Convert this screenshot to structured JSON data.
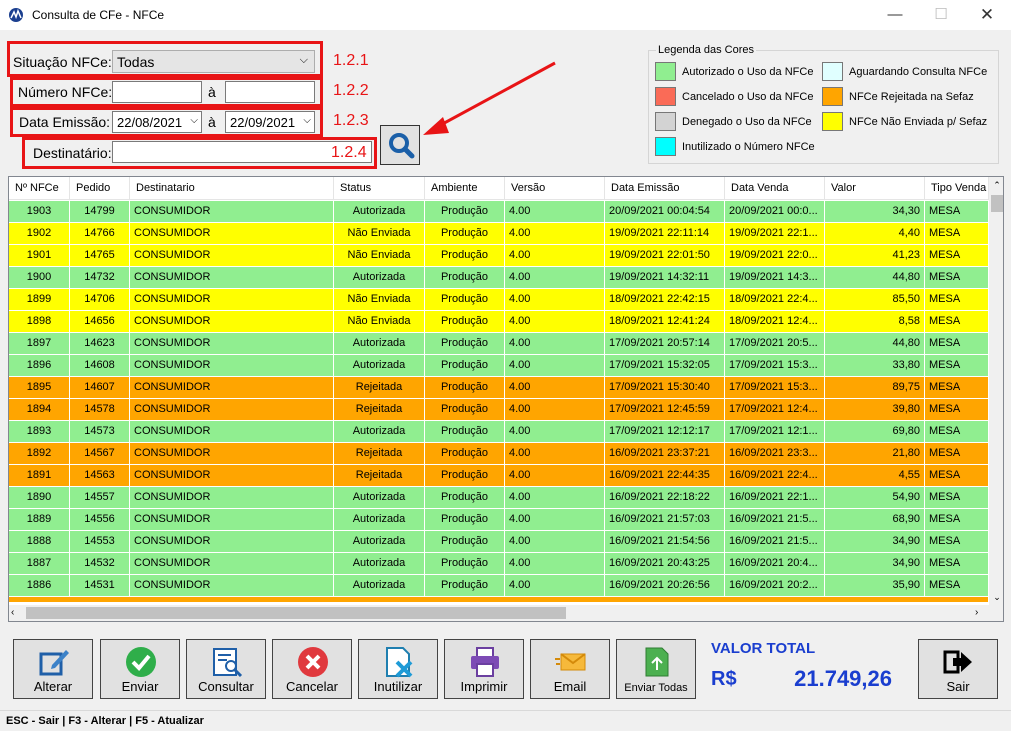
{
  "window": {
    "title": "Consulta de CFe - NFCe",
    "min": "—",
    "max": "☐",
    "close": "✕"
  },
  "filters": {
    "situacao_label": "Situação NFCe:",
    "situacao_value": "Todas",
    "numero_label": "Número NFCe:",
    "numero_sep": "à",
    "data_label": "Data Emissão:",
    "data_from": "22/08/2021",
    "data_sep": "à",
    "data_to": "22/09/2021",
    "dest_label": "Destinatário:"
  },
  "annotations": [
    "1.2.1",
    "1.2.2",
    "1.2.3",
    "1.2.4"
  ],
  "legend": {
    "title": "Legenda das Cores",
    "items": [
      {
        "label": "Autorizado o Uso da NFCe",
        "color": "#90ee90"
      },
      {
        "label": "Cancelado o Uso da NFCe",
        "color": "#fa6b57"
      },
      {
        "label": "Denegado o Uso da NFCe",
        "color": "#d3d3d3"
      },
      {
        "label": "Inutilizado o Número NFCe",
        "color": "#00ffff"
      },
      {
        "label": "Aguardando Consulta NFCe",
        "color": "#e0ffff"
      },
      {
        "label": "NFCe Rejeitada na Sefaz",
        "color": "#ffa500"
      },
      {
        "label": "NFCe Não Enviada p/ Sefaz",
        "color": "#ffff00"
      }
    ]
  },
  "table": {
    "columns": [
      "Nº NFCe",
      "Pedido",
      "Destinatario",
      "Status",
      "Ambiente",
      "Versão",
      "Data Emissão",
      "Data Venda",
      "Valor",
      "Tipo Venda"
    ],
    "rows": [
      [
        "1903",
        "14799",
        "CONSUMIDOR",
        "Autorizada",
        "Produção",
        "4.00",
        "20/09/2021 00:04:54",
        "20/09/2021 00:0...",
        "34,30",
        "MESA"
      ],
      [
        "1902",
        "14766",
        "CONSUMIDOR",
        "Não Enviada",
        "Produção",
        "4.00",
        "19/09/2021 22:11:14",
        "19/09/2021 22:1...",
        "4,40",
        "MESA"
      ],
      [
        "1901",
        "14765",
        "CONSUMIDOR",
        "Não Enviada",
        "Produção",
        "4.00",
        "19/09/2021 22:01:50",
        "19/09/2021 22:0...",
        "41,23",
        "MESA"
      ],
      [
        "1900",
        "14732",
        "CONSUMIDOR",
        "Autorizada",
        "Produção",
        "4.00",
        "19/09/2021 14:32:11",
        "19/09/2021 14:3...",
        "44,80",
        "MESA"
      ],
      [
        "1899",
        "14706",
        "CONSUMIDOR",
        "Não Enviada",
        "Produção",
        "4.00",
        "18/09/2021 22:42:15",
        "18/09/2021 22:4...",
        "85,50",
        "MESA"
      ],
      [
        "1898",
        "14656",
        "CONSUMIDOR",
        "Não Enviada",
        "Produção",
        "4.00",
        "18/09/2021 12:41:24",
        "18/09/2021 12:4...",
        "8,58",
        "MESA"
      ],
      [
        "1897",
        "14623",
        "CONSUMIDOR",
        "Autorizada",
        "Produção",
        "4.00",
        "17/09/2021 20:57:14",
        "17/09/2021 20:5...",
        "44,80",
        "MESA"
      ],
      [
        "1896",
        "14608",
        "CONSUMIDOR",
        "Autorizada",
        "Produção",
        "4.00",
        "17/09/2021 15:32:05",
        "17/09/2021 15:3...",
        "33,80",
        "MESA"
      ],
      [
        "1895",
        "14607",
        "CONSUMIDOR",
        "Rejeitada",
        "Produção",
        "4.00",
        "17/09/2021 15:30:40",
        "17/09/2021 15:3...",
        "89,75",
        "MESA"
      ],
      [
        "1894",
        "14578",
        "CONSUMIDOR",
        "Rejeitada",
        "Produção",
        "4.00",
        "17/09/2021 12:45:59",
        "17/09/2021 12:4...",
        "39,80",
        "MESA"
      ],
      [
        "1893",
        "14573",
        "CONSUMIDOR",
        "Autorizada",
        "Produção",
        "4.00",
        "17/09/2021 12:12:17",
        "17/09/2021 12:1...",
        "69,80",
        "MESA"
      ],
      [
        "1892",
        "14567",
        "CONSUMIDOR",
        "Rejeitada",
        "Produção",
        "4.00",
        "16/09/2021 23:37:21",
        "16/09/2021 23:3...",
        "21,80",
        "MESA"
      ],
      [
        "1891",
        "14563",
        "CONSUMIDOR",
        "Rejeitada",
        "Produção",
        "4.00",
        "16/09/2021 22:44:35",
        "16/09/2021 22:4...",
        "4,55",
        "MESA"
      ],
      [
        "1890",
        "14557",
        "CONSUMIDOR",
        "Autorizada",
        "Produção",
        "4.00",
        "16/09/2021 22:18:22",
        "16/09/2021 22:1...",
        "54,90",
        "MESA"
      ],
      [
        "1889",
        "14556",
        "CONSUMIDOR",
        "Autorizada",
        "Produção",
        "4.00",
        "16/09/2021 21:57:03",
        "16/09/2021 21:5...",
        "68,90",
        "MESA"
      ],
      [
        "1888",
        "14553",
        "CONSUMIDOR",
        "Autorizada",
        "Produção",
        "4.00",
        "16/09/2021 21:54:56",
        "16/09/2021 21:5...",
        "34,90",
        "MESA"
      ],
      [
        "1887",
        "14532",
        "CONSUMIDOR",
        "Autorizada",
        "Produção",
        "4.00",
        "16/09/2021 20:43:25",
        "16/09/2021 20:4...",
        "34,90",
        "MESA"
      ],
      [
        "1886",
        "14531",
        "CONSUMIDOR",
        "Autorizada",
        "Produção",
        "4.00",
        "16/09/2021 20:26:56",
        "16/09/2021 20:2...",
        "35,90",
        "MESA"
      ]
    ],
    "status_colors": {
      "Autorizada": "#90ee90",
      "Não Enviada": "#ffff00",
      "Rejeitada": "#ffa500"
    }
  },
  "toolbar": {
    "alterar": "Alterar",
    "enviar": "Enviar",
    "consultar": "Consultar",
    "cancelar": "Cancelar",
    "inutilizar": "Inutilizar",
    "imprimir": "Imprimir",
    "email": "Email",
    "enviar_todas": "Enviar Todas",
    "sair": "Sair"
  },
  "total": {
    "label": "VALOR TOTAL",
    "currency": "R$",
    "value": "21.749,26"
  },
  "statusbar": "ESC - Sair | F3 - Alterar | F5 - Atualizar"
}
